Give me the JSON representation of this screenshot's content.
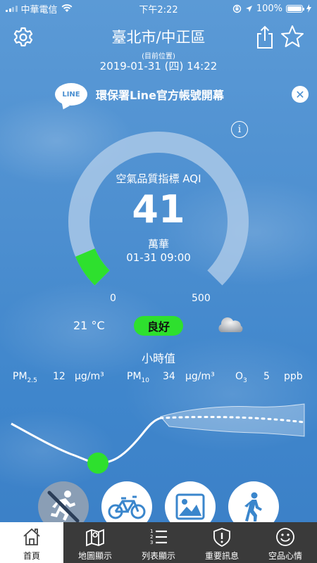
{
  "status_bar": {
    "carrier": "中華電信",
    "time": "下午2:22",
    "battery": "100%",
    "battery_level": 1.0,
    "signal_bars": 2
  },
  "header": {
    "city": "臺北市/中正區",
    "location_note": "(目前位置)",
    "datetime": "2019-01-31 (四) 14:22",
    "icons": [
      "settings-icon",
      "share-icon",
      "star-icon"
    ]
  },
  "banner": {
    "logo_text": "LINE",
    "text": "環保署Line官方帳號開幕",
    "close_icon": "close-icon"
  },
  "aqi": {
    "label": "空氣品質指標 AQI",
    "value": "41",
    "station": "萬華",
    "time": "01-31 09:00",
    "scale_min": "0",
    "scale_max": "500",
    "gauge_fraction": 0.082,
    "gauge_color": "#2ee02e",
    "track_color": "#a9c8e8"
  },
  "weather": {
    "temperature": "21 °C",
    "status": "良好",
    "status_color": "#2ee02e",
    "icon": "cloud-icon"
  },
  "hourly": {
    "title": "小時值",
    "pm25_label_main": "PM",
    "pm25_label_sub": "2.5",
    "pm25_value": "12",
    "pm25_unit": "μg/m³",
    "pm10_label_main": "PM",
    "pm10_label_sub": "10",
    "pm10_value": "34",
    "pm10_unit": "μg/m³",
    "o3_label_main": "O",
    "o3_label_sub": "3",
    "o3_value": "5",
    "o3_unit": "ppb"
  },
  "activities": [
    {
      "name": "running",
      "icon": "running-prohibited-icon"
    },
    {
      "name": "cycling",
      "icon": "bicycle-icon"
    },
    {
      "name": "photo",
      "icon": "photo-icon"
    },
    {
      "name": "walking",
      "icon": "walking-icon"
    }
  ],
  "tabs": [
    {
      "label": "首頁",
      "icon": "home-icon",
      "active": true
    },
    {
      "label": "地圖顯示",
      "icon": "map-icon",
      "active": false
    },
    {
      "label": "列表顯示",
      "icon": "list-icon",
      "active": false
    },
    {
      "label": "重要訊息",
      "icon": "alert-shield-icon",
      "active": false
    },
    {
      "label": "空品心情",
      "icon": "smile-icon",
      "active": false
    }
  ]
}
